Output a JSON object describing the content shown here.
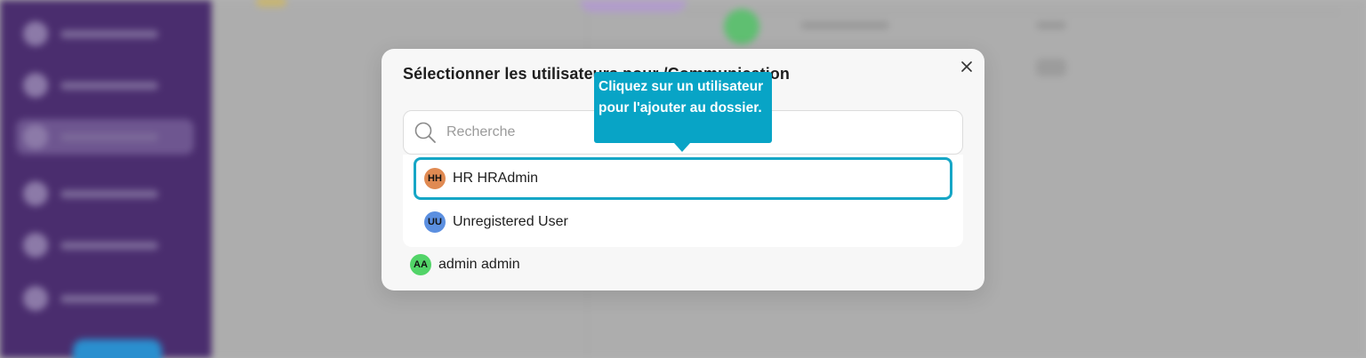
{
  "modal": {
    "title": "Sélectionner les utilisateurs pour /Communication",
    "close_icon": "close-icon",
    "search": {
      "placeholder": "Recherche",
      "value": "",
      "icon": "search-icon"
    },
    "dropdown": {
      "users": [
        {
          "initials": "HH",
          "name": "HR HRAdmin",
          "avatar_color": "#e08a52",
          "selected": true
        },
        {
          "initials": "UU",
          "name": "Unregistered User",
          "avatar_color": "#5b8fe0",
          "selected": false
        }
      ]
    },
    "members": [
      {
        "initials": "AA",
        "name": "admin admin",
        "avatar_color": "#52d468"
      }
    ]
  },
  "tooltip": {
    "text": "Cliquez sur un utilisateur pour l'ajouter au dossier."
  },
  "colors": {
    "accent": "#16a6c6",
    "tooltip_bg": "#08a4c6",
    "sidebar": "#4a2d6e"
  }
}
